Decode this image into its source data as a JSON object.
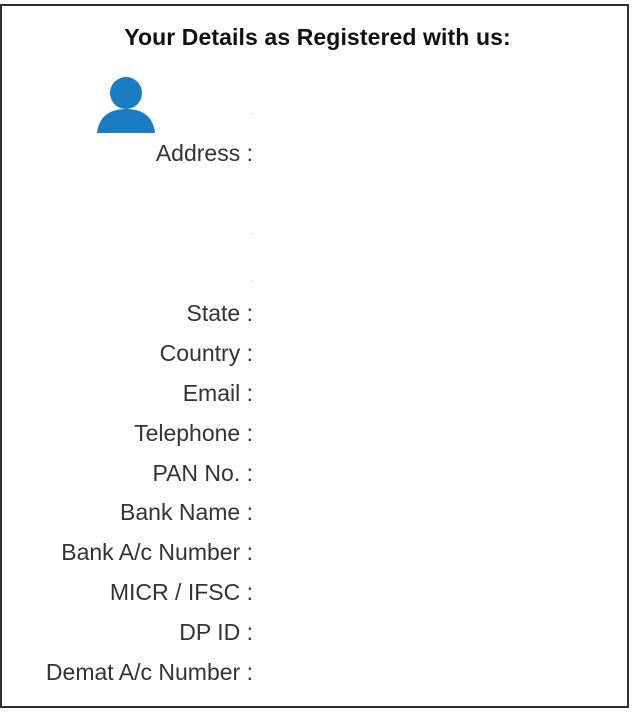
{
  "title": "Your Details as Registered with us:",
  "avatar_icon": "user-icon",
  "accent_color": "#1a7dc4",
  "fields": {
    "address": "Address :",
    "state": "State :",
    "country": "Country :",
    "email": "Email :",
    "telephone": "Telephone :",
    "pan": "PAN No. :",
    "bank_name": "Bank Name :",
    "bank_account": "Bank A/c Number :",
    "micr_ifsc": "MICR / IFSC :",
    "dp_id": "DP ID :",
    "demat_account": "Demat A/c Number :"
  }
}
